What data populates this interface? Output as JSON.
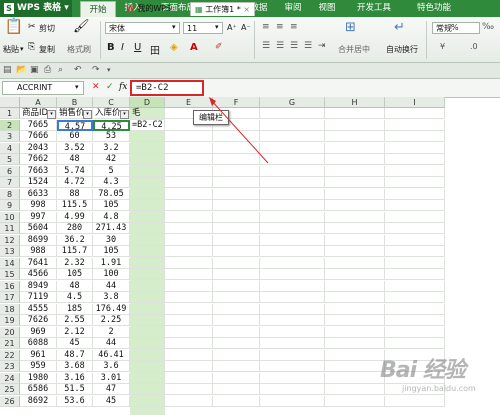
{
  "app": {
    "name": "WPS 表格",
    "logo_letter": "S"
  },
  "ribbon_tabs": [
    "开始",
    "插入",
    "页面布局",
    "公式",
    "数据",
    "审阅",
    "视图",
    "开发工具",
    "特色功能"
  ],
  "ribbon": {
    "clipboard": {
      "paste": "粘贴",
      "cut": "剪切",
      "copy": "复制",
      "format_painter": "格式刷"
    },
    "font": {
      "name": "宋体",
      "size": "11",
      "size_up": "A⁺",
      "size_down": "A⁻"
    },
    "format_buttons": [
      "B",
      "I",
      "U",
      "田",
      "◈",
      "A"
    ],
    "merge": "合并居中",
    "wrap": "自动换行",
    "number_format": "常规",
    "percent": "%"
  },
  "doc_tabs": [
    {
      "label": "我的WPS"
    },
    {
      "label": "工作簿1 *"
    }
  ],
  "formula_bar": {
    "name_box": "ACCRINT",
    "formula": "=B2-C2",
    "fx": "fx",
    "cancel": "✕",
    "confirm": "✓"
  },
  "grid": {
    "columns": [
      "A",
      "B",
      "C",
      "D",
      "E",
      "F",
      "G",
      "H",
      "I"
    ],
    "headers": [
      "商品ID",
      "销售价",
      "入库价",
      "毛"
    ],
    "editing_cell_text": "=B2-C2",
    "tooltip": "编辑栏",
    "rows": [
      {
        "n": "1"
      },
      {
        "n": "2",
        "a": "7665",
        "b": "4.57",
        "c": "4.25"
      },
      {
        "n": "3",
        "a": "7666",
        "b": "60",
        "c": "53"
      },
      {
        "n": "4",
        "a": "2043",
        "b": "3.52",
        "c": "3.2"
      },
      {
        "n": "5",
        "a": "7662",
        "b": "48",
        "c": "42"
      },
      {
        "n": "6",
        "a": "7663",
        "b": "5.74",
        "c": "5"
      },
      {
        "n": "7",
        "a": "1524",
        "b": "4.72",
        "c": "4.3"
      },
      {
        "n": "8",
        "a": "6633",
        "b": "88",
        "c": "78.05"
      },
      {
        "n": "9",
        "a": "998",
        "b": "115.5",
        "c": "105"
      },
      {
        "n": "10",
        "a": "997",
        "b": "4.99",
        "c": "4.8"
      },
      {
        "n": "11",
        "a": "5604",
        "b": "280",
        "c": "271.43"
      },
      {
        "n": "12",
        "a": "8699",
        "b": "36.2",
        "c": "30"
      },
      {
        "n": "13",
        "a": "988",
        "b": "115.7",
        "c": "105"
      },
      {
        "n": "14",
        "a": "7641",
        "b": "2.32",
        "c": "1.91"
      },
      {
        "n": "15",
        "a": "4566",
        "b": "105",
        "c": "100"
      },
      {
        "n": "16",
        "a": "8949",
        "b": "48",
        "c": "44"
      },
      {
        "n": "17",
        "a": "7119",
        "b": "4.5",
        "c": "3.8"
      },
      {
        "n": "18",
        "a": "4555",
        "b": "185",
        "c": "176.49"
      },
      {
        "n": "19",
        "a": "7626",
        "b": "2.55",
        "c": "2.25"
      },
      {
        "n": "20",
        "a": "969",
        "b": "2.12",
        "c": "2"
      },
      {
        "n": "21",
        "a": "6088",
        "b": "45",
        "c": "44"
      },
      {
        "n": "22",
        "a": "961",
        "b": "48.7",
        "c": "46.41"
      },
      {
        "n": "23",
        "a": "959",
        "b": "3.68",
        "c": "3.6"
      },
      {
        "n": "24",
        "a": "1980",
        "b": "3.16",
        "c": "3.01"
      },
      {
        "n": "25",
        "a": "6586",
        "b": "51.5",
        "c": "47"
      },
      {
        "n": "26",
        "a": "8692",
        "b": "53.6",
        "c": "45"
      }
    ]
  },
  "watermark": {
    "text": "Bai 经验",
    "sub": "jingyan.baidu.com"
  },
  "colors": {
    "ribbon_green": "#2f8a3c",
    "selected_column": "#d6edcc",
    "annotation_red": "#d9262b"
  }
}
